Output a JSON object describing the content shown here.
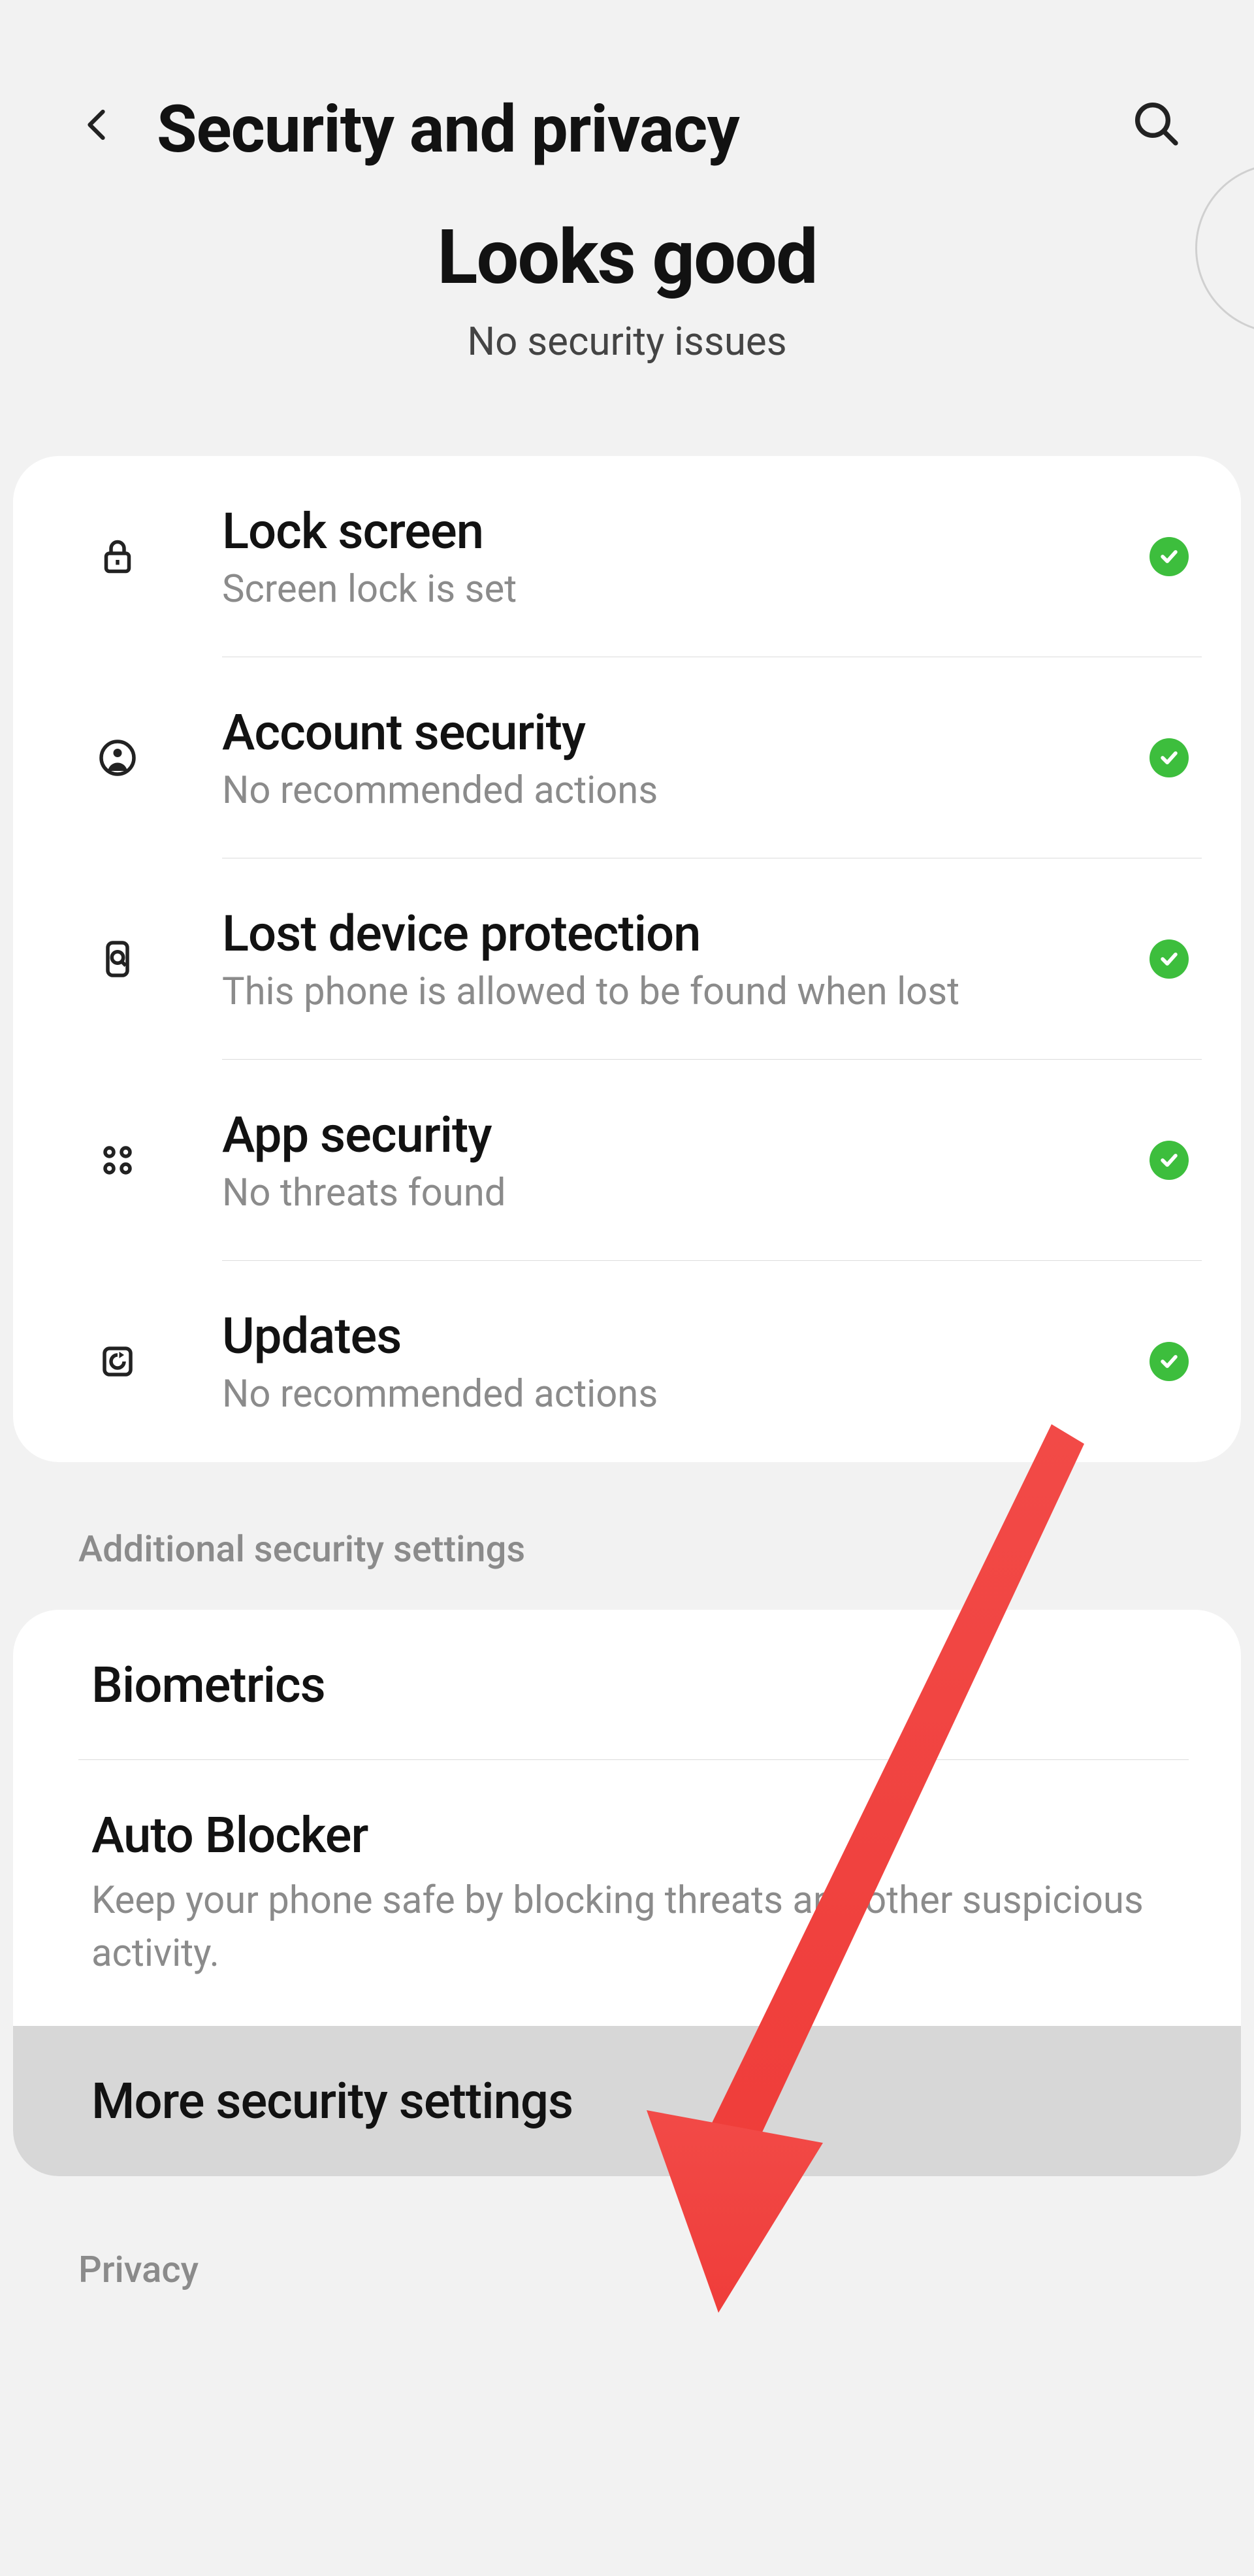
{
  "header": {
    "title": "Security and privacy"
  },
  "hero": {
    "title": "Looks good",
    "subtitle": "No security issues"
  },
  "security_items": [
    {
      "title": "Lock screen",
      "subtitle": "Screen lock is set",
      "icon": "lock"
    },
    {
      "title": "Account security",
      "subtitle": "No recommended actions",
      "icon": "person"
    },
    {
      "title": "Lost device protection",
      "subtitle": "This phone is allowed to be found when lost",
      "icon": "device-search"
    },
    {
      "title": "App security",
      "subtitle": "No threats found",
      "icon": "apps"
    },
    {
      "title": "Updates",
      "subtitle": "No recommended actions",
      "icon": "update"
    }
  ],
  "section_label": "Additional security settings",
  "additional": [
    {
      "title": "Biometrics",
      "subtitle": ""
    },
    {
      "title": "Auto Blocker",
      "subtitle": "Keep your phone safe by blocking threats and other suspicious activity."
    },
    {
      "title": "More security settings",
      "subtitle": "",
      "highlighted": true
    }
  ],
  "footer_label": "Privacy"
}
